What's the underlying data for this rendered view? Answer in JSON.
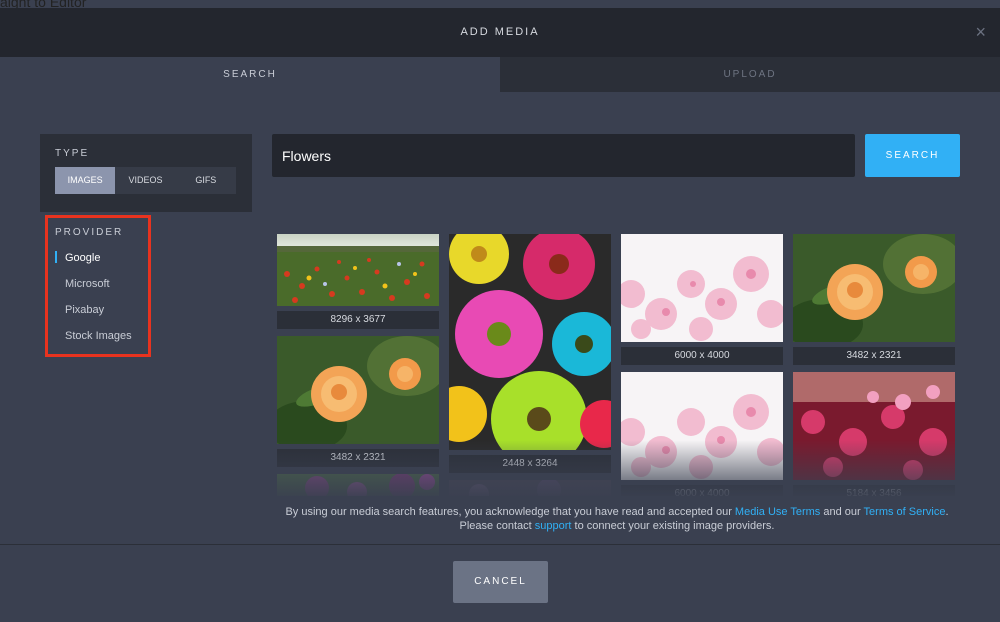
{
  "background_text": "aight to Editor",
  "header": {
    "title": "ADD MEDIA",
    "close_glyph": "×"
  },
  "tabs": [
    {
      "label": "SEARCH",
      "active": true
    },
    {
      "label": "UPLOAD",
      "active": false
    }
  ],
  "type_panel": {
    "label": "TYPE",
    "options": [
      "IMAGES",
      "VIDEOS",
      "GIFS"
    ],
    "selected": "IMAGES"
  },
  "provider_panel": {
    "label": "PROVIDER",
    "items": [
      "Google",
      "Microsoft",
      "Pixabay",
      "Stock Images"
    ],
    "selected": "Google"
  },
  "search": {
    "value": "Flowers",
    "button_label": "SEARCH"
  },
  "results": [
    {
      "caption": "8296 x 3677",
      "subject": "poppy-field"
    },
    {
      "caption": "3482 x 2321",
      "subject": "orange-roses"
    },
    {
      "caption": "",
      "subject": "purple-flowers"
    },
    {
      "caption": "2448 x 3264",
      "subject": "colorful-gerbera-daisies"
    },
    {
      "caption": "",
      "subject": "dark-flowers"
    },
    {
      "caption": "6000 x 4000",
      "subject": "pink-cherry-blossoms"
    },
    {
      "caption": "6000 x 4000",
      "subject": "pink-cherry-blossoms"
    },
    {
      "caption": "3482 x 2321",
      "subject": "orange-roses"
    },
    {
      "caption": "5184 x 3456",
      "subject": "pink-red-blossoms"
    }
  ],
  "disclaimer": {
    "text_1": "By using our media search features, you acknowledge that you have read and accepted our ",
    "link_1": "Media Use Terms",
    "text_2": " and our ",
    "link_2": "Terms of Service",
    "text_3": ". Please contact ",
    "link_3": "support",
    "text_4": " to connect your existing image providers."
  },
  "footer": {
    "cancel_label": "CANCEL"
  },
  "colors": {
    "accent": "#31b0f5",
    "highlight_box": "#e8331f",
    "modal_bg": "#3a4050",
    "header_bg": "#23262e"
  }
}
